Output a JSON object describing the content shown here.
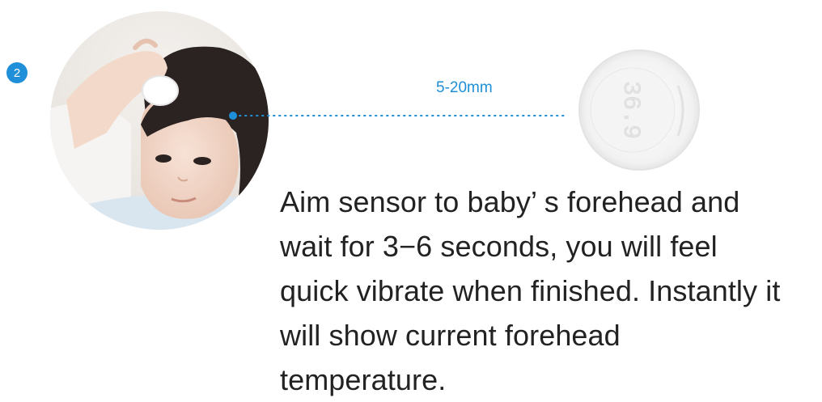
{
  "step": {
    "number": "2",
    "color": "#1e8fd8"
  },
  "distance": {
    "label": "5-20mm",
    "color": "#1e8fd8"
  },
  "device": {
    "display_reading": "36.9"
  },
  "instructions": {
    "lines": [
      "Aim sensor to baby’ s forehead and",
      "wait for 3−6 seconds, you will feel",
      "quick vibrate when finished. Instantly it",
      "will show current forehead",
      "temperature."
    ]
  },
  "photo": {
    "subject": "baby-with-sensor-on-forehead"
  }
}
